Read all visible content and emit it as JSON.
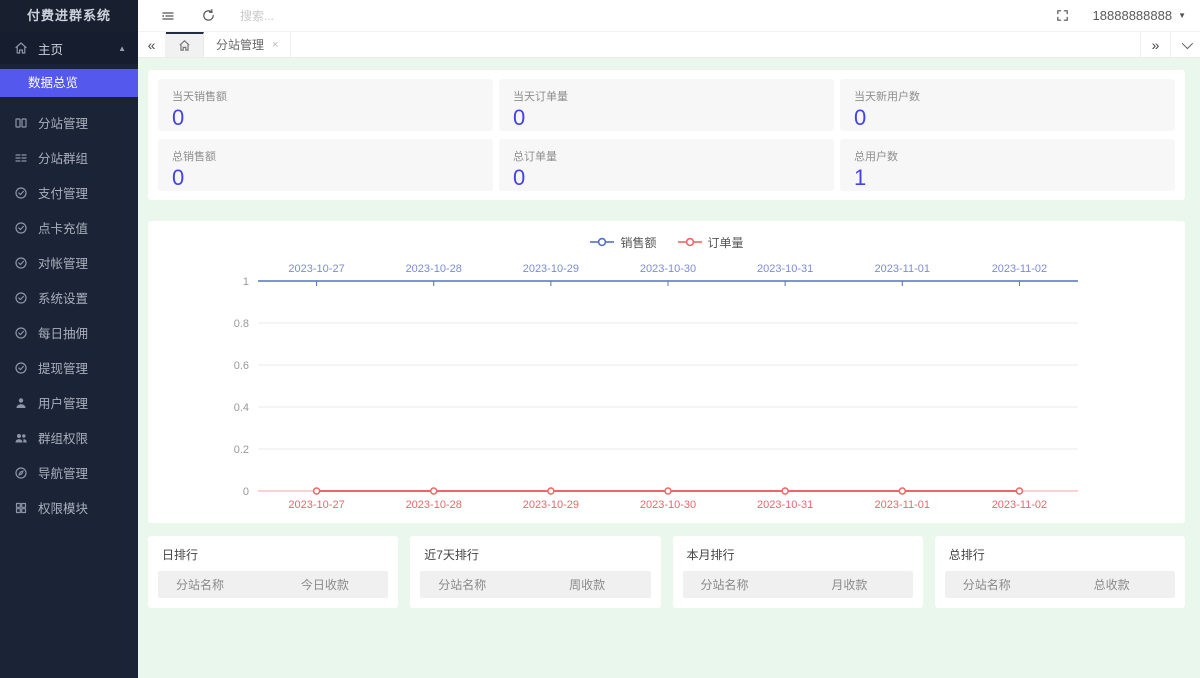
{
  "app": {
    "title": "付费进群系统",
    "search_placeholder": "搜索...",
    "user_phone": "18888888888"
  },
  "sidebar": {
    "group_label": "主页",
    "active_item": "数据总览",
    "items": [
      "分站管理",
      "分站群组",
      "支付管理",
      "点卡充值",
      "对帐管理",
      "系统设置",
      "每日抽佣",
      "提现管理",
      "用户管理",
      "群组权限",
      "导航管理",
      "权限模块"
    ]
  },
  "tabs": {
    "open_tab": "分站管理",
    "close_glyph": "×"
  },
  "stats": {
    "items": [
      {
        "label": "当天销售额",
        "value": "0"
      },
      {
        "label": "当天订单量",
        "value": "0"
      },
      {
        "label": "当天新用户数",
        "value": "0"
      },
      {
        "label": "总销售额",
        "value": "0"
      },
      {
        "label": "总订单量",
        "value": "0"
      },
      {
        "label": "总用户数",
        "value": "1"
      }
    ]
  },
  "chart_data": {
    "type": "line",
    "x": [
      "2023-10-27",
      "2023-10-28",
      "2023-10-29",
      "2023-10-30",
      "2023-10-31",
      "2023-11-01",
      "2023-11-02"
    ],
    "series": [
      {
        "name": "销售额",
        "color": "#5470c6",
        "label_color": "#7b8cd8",
        "values": [
          0,
          0,
          0,
          0,
          0,
          0,
          0
        ],
        "axis": "top"
      },
      {
        "name": "订单量",
        "color": "#ee6666",
        "label_color": "#e36a6a",
        "values": [
          0,
          0,
          0,
          0,
          0,
          0,
          0
        ],
        "axis": "bottom"
      }
    ],
    "yticks": [
      0,
      0.2,
      0.4,
      0.6,
      0.8,
      1
    ],
    "ylim": [
      0,
      1
    ],
    "legend_position": "top-center",
    "grid": true
  },
  "rankings": [
    {
      "title": "日排行",
      "col1": "分站名称",
      "col2": "今日收款"
    },
    {
      "title": "近7天排行",
      "col1": "分站名称",
      "col2": "周收款"
    },
    {
      "title": "本月排行",
      "col1": "分站名称",
      "col2": "月收款"
    },
    {
      "title": "总排行",
      "col1": "分站名称",
      "col2": "总收款"
    }
  ],
  "colors": {
    "sidebar_bg": "#1b2336",
    "sidebar_active": "#5458ec",
    "page_bg": "#eaf7ec",
    "stat_value": "#4343ea",
    "series_blue": "#5470c6",
    "series_red": "#ee6666"
  }
}
